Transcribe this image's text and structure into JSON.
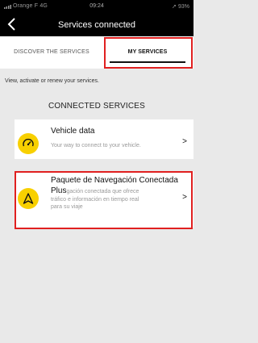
{
  "status_bar": {
    "carrier": "Orange F  4G",
    "time": "09:24",
    "battery": "93%"
  },
  "header": {
    "title": "Services connected",
    "back_icon": "chevron-left-icon"
  },
  "tabs": [
    {
      "label": "DISCOVER THE SERVICES",
      "active": false
    },
    {
      "label": "MY SERVICES",
      "active": true
    }
  ],
  "intro_text": "View, activate or renew your services.",
  "section_title": "CONNECTED SERVICES",
  "services": [
    {
      "name": "Vehicle data",
      "description": "Your way to connect to your vehicle.",
      "icon": "speedometer-icon"
    },
    {
      "name_line1": "Paquete de Navegación Conectada",
      "name_line2": "Plus",
      "description_line1": "gación conectada que ofrece",
      "description_rest": "tráfico e información en tiempo real para su viaje",
      "icon": "navigation-arrow-icon"
    }
  ],
  "colors": {
    "accent": "#f8d000",
    "highlight": "#e02020",
    "background": "#e9e9e9"
  }
}
